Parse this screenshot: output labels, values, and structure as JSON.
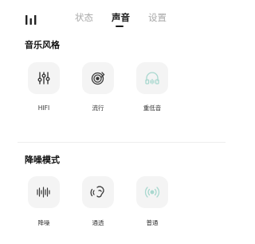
{
  "header": {
    "menu_icon": "menu-bars-icon",
    "tabs": [
      {
        "label": "状态",
        "active": false
      },
      {
        "label": "声音",
        "active": true
      },
      {
        "label": "设置",
        "active": false
      }
    ]
  },
  "music_style": {
    "title": "音乐风格",
    "options": [
      {
        "label": "HIFI",
        "icon": "equalizer-sliders-icon",
        "selected": false
      },
      {
        "label": "流行",
        "icon": "vinyl-record-icon",
        "selected": false
      },
      {
        "label": "重低音",
        "icon": "headphones-icon",
        "selected": false
      }
    ]
  },
  "noise_mode": {
    "title": "降噪模式",
    "options": [
      {
        "label": "降噪",
        "icon": "sound-wave-icon",
        "selected": false
      },
      {
        "label": "通透",
        "icon": "ear-icon",
        "selected": false
      },
      {
        "label": "普通",
        "icon": "broadcast-icon",
        "selected": false
      }
    ]
  },
  "colors": {
    "active_text": "#1b1b1b",
    "inactive_text": "#a8a8a8",
    "tile_bg": "#f4f4f4",
    "icon_dark": "#3a3a3a",
    "icon_teal_light": "#a9d8cf"
  }
}
